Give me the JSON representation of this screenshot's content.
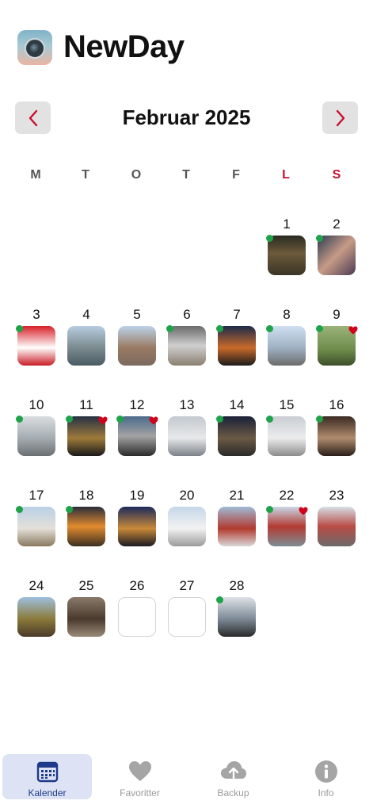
{
  "app": {
    "title": "NewDay"
  },
  "calendar": {
    "month_title": "Februar 2025",
    "weekdays": [
      "M",
      "T",
      "O",
      "T",
      "F",
      "L",
      "S"
    ],
    "weekend_color": "#c8102e",
    "days": [
      {
        "day": "1",
        "photo": true,
        "dot": true,
        "heart": false
      },
      {
        "day": "2",
        "photo": true,
        "dot": true,
        "heart": false
      },
      {
        "day": "3",
        "photo": true,
        "dot": true,
        "heart": false
      },
      {
        "day": "4",
        "photo": true,
        "dot": false,
        "heart": false
      },
      {
        "day": "5",
        "photo": true,
        "dot": false,
        "heart": false
      },
      {
        "day": "6",
        "photo": true,
        "dot": true,
        "heart": false
      },
      {
        "day": "7",
        "photo": true,
        "dot": true,
        "heart": false
      },
      {
        "day": "8",
        "photo": true,
        "dot": true,
        "heart": false
      },
      {
        "day": "9",
        "photo": true,
        "dot": true,
        "heart": true
      },
      {
        "day": "10",
        "photo": true,
        "dot": true,
        "heart": false
      },
      {
        "day": "11",
        "photo": true,
        "dot": true,
        "heart": true
      },
      {
        "day": "12",
        "photo": true,
        "dot": true,
        "heart": true
      },
      {
        "day": "13",
        "photo": true,
        "dot": false,
        "heart": false
      },
      {
        "day": "14",
        "photo": true,
        "dot": true,
        "heart": false
      },
      {
        "day": "15",
        "photo": true,
        "dot": true,
        "heart": false
      },
      {
        "day": "16",
        "photo": true,
        "dot": true,
        "heart": false
      },
      {
        "day": "17",
        "photo": true,
        "dot": true,
        "heart": false
      },
      {
        "day": "18",
        "photo": true,
        "dot": true,
        "heart": false
      },
      {
        "day": "19",
        "photo": true,
        "dot": false,
        "heart": false
      },
      {
        "day": "20",
        "photo": true,
        "dot": false,
        "heart": false
      },
      {
        "day": "21",
        "photo": true,
        "dot": false,
        "heart": false
      },
      {
        "day": "22",
        "photo": true,
        "dot": true,
        "heart": true
      },
      {
        "day": "23",
        "photo": true,
        "dot": false,
        "heart": false
      },
      {
        "day": "24",
        "photo": true,
        "dot": false,
        "heart": false
      },
      {
        "day": "25",
        "photo": true,
        "dot": false,
        "heart": false
      },
      {
        "day": "26",
        "photo": false,
        "dot": false,
        "heart": false
      },
      {
        "day": "27",
        "photo": false,
        "dot": false,
        "heart": false
      },
      {
        "day": "28",
        "photo": true,
        "dot": true,
        "heart": false
      }
    ]
  },
  "tabs": [
    {
      "label": "Kalender",
      "icon": "calendar-icon",
      "active": true
    },
    {
      "label": "Favoritter",
      "icon": "heart-icon",
      "active": false
    },
    {
      "label": "Backup",
      "icon": "cloud-upload-icon",
      "active": false
    },
    {
      "label": "Info",
      "icon": "info-icon",
      "active": false
    }
  ],
  "colors": {
    "accent": "#1d3a8a",
    "nav_arrow": "#c8102e",
    "dot": "#1fa34a",
    "heart": "#d0021b"
  }
}
